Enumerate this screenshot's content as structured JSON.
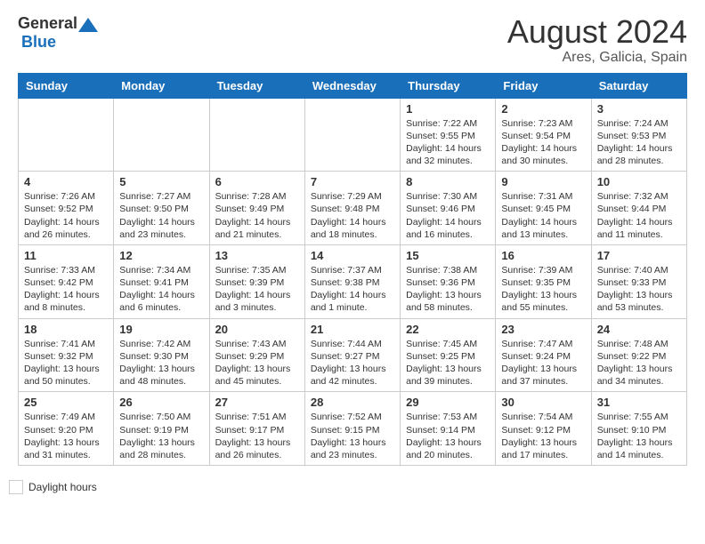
{
  "header": {
    "logo_general": "General",
    "logo_blue": "Blue",
    "month_year": "August 2024",
    "location": "Ares, Galicia, Spain"
  },
  "legend": {
    "label": "Daylight hours"
  },
  "days_of_week": [
    "Sunday",
    "Monday",
    "Tuesday",
    "Wednesday",
    "Thursday",
    "Friday",
    "Saturday"
  ],
  "weeks": [
    {
      "days": [
        {
          "num": "",
          "info": ""
        },
        {
          "num": "",
          "info": ""
        },
        {
          "num": "",
          "info": ""
        },
        {
          "num": "",
          "info": ""
        },
        {
          "num": "1",
          "info": "Sunrise: 7:22 AM\nSunset: 9:55 PM\nDaylight: 14 hours\nand 32 minutes."
        },
        {
          "num": "2",
          "info": "Sunrise: 7:23 AM\nSunset: 9:54 PM\nDaylight: 14 hours\nand 30 minutes."
        },
        {
          "num": "3",
          "info": "Sunrise: 7:24 AM\nSunset: 9:53 PM\nDaylight: 14 hours\nand 28 minutes."
        }
      ]
    },
    {
      "days": [
        {
          "num": "4",
          "info": "Sunrise: 7:26 AM\nSunset: 9:52 PM\nDaylight: 14 hours\nand 26 minutes."
        },
        {
          "num": "5",
          "info": "Sunrise: 7:27 AM\nSunset: 9:50 PM\nDaylight: 14 hours\nand 23 minutes."
        },
        {
          "num": "6",
          "info": "Sunrise: 7:28 AM\nSunset: 9:49 PM\nDaylight: 14 hours\nand 21 minutes."
        },
        {
          "num": "7",
          "info": "Sunrise: 7:29 AM\nSunset: 9:48 PM\nDaylight: 14 hours\nand 18 minutes."
        },
        {
          "num": "8",
          "info": "Sunrise: 7:30 AM\nSunset: 9:46 PM\nDaylight: 14 hours\nand 16 minutes."
        },
        {
          "num": "9",
          "info": "Sunrise: 7:31 AM\nSunset: 9:45 PM\nDaylight: 14 hours\nand 13 minutes."
        },
        {
          "num": "10",
          "info": "Sunrise: 7:32 AM\nSunset: 9:44 PM\nDaylight: 14 hours\nand 11 minutes."
        }
      ]
    },
    {
      "days": [
        {
          "num": "11",
          "info": "Sunrise: 7:33 AM\nSunset: 9:42 PM\nDaylight: 14 hours\nand 8 minutes."
        },
        {
          "num": "12",
          "info": "Sunrise: 7:34 AM\nSunset: 9:41 PM\nDaylight: 14 hours\nand 6 minutes."
        },
        {
          "num": "13",
          "info": "Sunrise: 7:35 AM\nSunset: 9:39 PM\nDaylight: 14 hours\nand 3 minutes."
        },
        {
          "num": "14",
          "info": "Sunrise: 7:37 AM\nSunset: 9:38 PM\nDaylight: 14 hours\nand 1 minute."
        },
        {
          "num": "15",
          "info": "Sunrise: 7:38 AM\nSunset: 9:36 PM\nDaylight: 13 hours\nand 58 minutes."
        },
        {
          "num": "16",
          "info": "Sunrise: 7:39 AM\nSunset: 9:35 PM\nDaylight: 13 hours\nand 55 minutes."
        },
        {
          "num": "17",
          "info": "Sunrise: 7:40 AM\nSunset: 9:33 PM\nDaylight: 13 hours\nand 53 minutes."
        }
      ]
    },
    {
      "days": [
        {
          "num": "18",
          "info": "Sunrise: 7:41 AM\nSunset: 9:32 PM\nDaylight: 13 hours\nand 50 minutes."
        },
        {
          "num": "19",
          "info": "Sunrise: 7:42 AM\nSunset: 9:30 PM\nDaylight: 13 hours\nand 48 minutes."
        },
        {
          "num": "20",
          "info": "Sunrise: 7:43 AM\nSunset: 9:29 PM\nDaylight: 13 hours\nand 45 minutes."
        },
        {
          "num": "21",
          "info": "Sunrise: 7:44 AM\nSunset: 9:27 PM\nDaylight: 13 hours\nand 42 minutes."
        },
        {
          "num": "22",
          "info": "Sunrise: 7:45 AM\nSunset: 9:25 PM\nDaylight: 13 hours\nand 39 minutes."
        },
        {
          "num": "23",
          "info": "Sunrise: 7:47 AM\nSunset: 9:24 PM\nDaylight: 13 hours\nand 37 minutes."
        },
        {
          "num": "24",
          "info": "Sunrise: 7:48 AM\nSunset: 9:22 PM\nDaylight: 13 hours\nand 34 minutes."
        }
      ]
    },
    {
      "days": [
        {
          "num": "25",
          "info": "Sunrise: 7:49 AM\nSunset: 9:20 PM\nDaylight: 13 hours\nand 31 minutes."
        },
        {
          "num": "26",
          "info": "Sunrise: 7:50 AM\nSunset: 9:19 PM\nDaylight: 13 hours\nand 28 minutes."
        },
        {
          "num": "27",
          "info": "Sunrise: 7:51 AM\nSunset: 9:17 PM\nDaylight: 13 hours\nand 26 minutes."
        },
        {
          "num": "28",
          "info": "Sunrise: 7:52 AM\nSunset: 9:15 PM\nDaylight: 13 hours\nand 23 minutes."
        },
        {
          "num": "29",
          "info": "Sunrise: 7:53 AM\nSunset: 9:14 PM\nDaylight: 13 hours\nand 20 minutes."
        },
        {
          "num": "30",
          "info": "Sunrise: 7:54 AM\nSunset: 9:12 PM\nDaylight: 13 hours\nand 17 minutes."
        },
        {
          "num": "31",
          "info": "Sunrise: 7:55 AM\nSunset: 9:10 PM\nDaylight: 13 hours\nand 14 minutes."
        }
      ]
    }
  ]
}
